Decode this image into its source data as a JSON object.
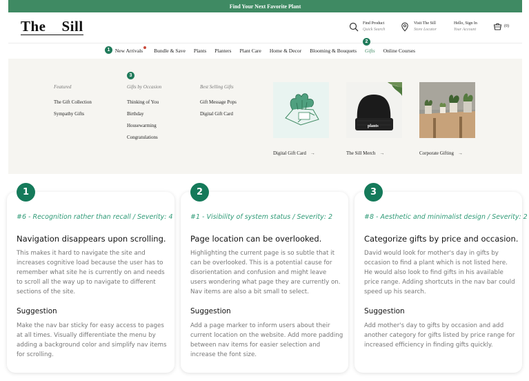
{
  "banner": {
    "text": "Find Your Next Favorite Plant"
  },
  "header": {
    "logo": "The    Sill",
    "find": {
      "title": "Find Product",
      "sub": "Quick Search"
    },
    "visit": {
      "title": "Visit The Sill",
      "sub": "Store Locator"
    },
    "account": {
      "title": "Hello, Sign In",
      "sub": "Your Account"
    },
    "cart_count": "(0)"
  },
  "nav": {
    "items": [
      "New Arrivals",
      "Bundle & Save",
      "Plants",
      "Planters",
      "Plant Care",
      "Home & Decor",
      "Blooming & Bouquets",
      "Gifts",
      "Online Courses"
    ],
    "active": "Gifts",
    "markers": [
      "1",
      "2",
      "3"
    ]
  },
  "mega": {
    "featured": {
      "heading": "Featured",
      "links": [
        "The Gift Collection",
        "Sympathy Gifts"
      ]
    },
    "occasion": {
      "heading": "Gifts by Occasion",
      "links": [
        "Thinking of You",
        "Birthday",
        "Housewarming",
        "Congratulations"
      ]
    },
    "best": {
      "heading": "Best Selling Gifts",
      "links": [
        "Gift Message Pops",
        "Digital Gift Card"
      ]
    },
    "tiles": [
      {
        "caption": "Digital Gift Card",
        "arrow": "→"
      },
      {
        "caption": "The Sill Merch",
        "arrow": "→"
      },
      {
        "caption": "Corporate Gifting",
        "arrow": "→"
      }
    ],
    "beanie_text": "plants"
  },
  "cards": [
    {
      "number": "1",
      "heuristic": "#6 - Recognition rather than recall / Severity: 4",
      "title": "Navigation disappears upon scrolling.",
      "description": "This makes it hard to navigate the site and increases cognitive load because the user has to remember what site he is currently on and needs to scroll all the way up to navigate to different sections of the site.",
      "suggestion_title": "Suggestion",
      "suggestion": "Make the nav bar sticky for easy access to pages at all times. Visually differentiate the menu by adding a background color and simplify nav items for scrolling."
    },
    {
      "number": "2",
      "heuristic": "#1 - Visibility of system status / Severity: 2",
      "title": "Page location can be overlooked.",
      "description": "Highlighting the current page is so subtle that it can be overlooked. This is a potential cause for disorientation and confusion and might leave users wondering what page they are currently on. Nav items are also a bit small to select.",
      "suggestion_title": "Suggestion",
      "suggestion": "Add a page marker to inform users about their current location on the website. Add more padding between nav items for easier selection and increase the font size."
    },
    {
      "number": "3",
      "heuristic": "#8 - Aesthetic and minimalist design / Severity: 2",
      "title": "Categorize gifts by price and occasion.",
      "description": "David would look for mother's day in gifts by occasion to find a plant which is not listed here. He would also look to find gifts in his available price range. Adding shortcuts in the nav bar could speed up his search.",
      "suggestion_title": "Suggestion",
      "suggestion": "Add mother's day to gifts by occasion and add another category for gifts listed by price range for increased efficiency in finding gifts quickly."
    }
  ],
  "colors": {
    "brand": "#3f8a63",
    "accent_text": "#2e9a76",
    "marker": "#157a5a"
  }
}
